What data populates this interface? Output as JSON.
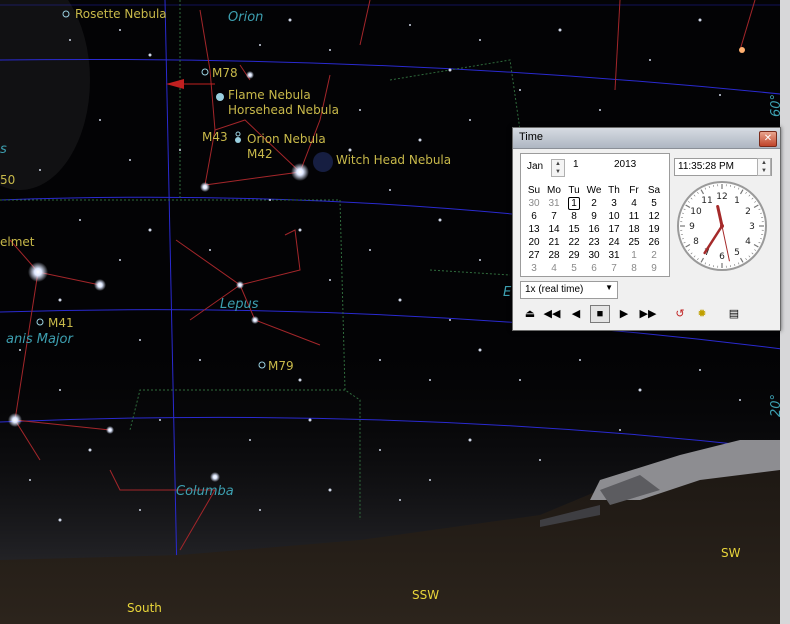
{
  "sky": {
    "labels": {
      "rosette": "Rosette Nebula",
      "orion": "Orion",
      "m78": "M78",
      "flame": "Flame Nebula",
      "horsehead": "Horsehead Nebula",
      "m43": "M43",
      "orion_nebula": "Orion Nebula",
      "m42": "M42",
      "witch_head": "Witch Head Nebula",
      "lepus": "Lepus",
      "m41": "M41",
      "canis_major": "anis Major",
      "helmet": "elmet",
      "m79": "M79",
      "columba": "Columba",
      "edge_s": "s",
      "edge_50": "50",
      "right_edge_top": "60°",
      "right_edge_bottom": "20°",
      "right_e": "E"
    },
    "directions": {
      "south": "South",
      "ssw": "SSW",
      "sw": "SW"
    },
    "colors": {
      "label": "#c8b94a",
      "constellation": "#3d9fb0",
      "direction": "#e8d53a"
    }
  },
  "time_dialog": {
    "title": "Time",
    "close_icon": "close-icon",
    "month": "Jan",
    "day": "1",
    "year": "2013",
    "weekdays": [
      "Su",
      "Mo",
      "Tu",
      "We",
      "Th",
      "Fr",
      "Sa"
    ],
    "weeks": [
      [
        "30",
        "31",
        "1",
        "2",
        "3",
        "4",
        "5"
      ],
      [
        "6",
        "7",
        "8",
        "9",
        "10",
        "11",
        "12"
      ],
      [
        "13",
        "14",
        "15",
        "16",
        "17",
        "18",
        "19"
      ],
      [
        "20",
        "21",
        "22",
        "23",
        "24",
        "25",
        "26"
      ],
      [
        "27",
        "28",
        "29",
        "30",
        "31",
        "1",
        "2"
      ],
      [
        "3",
        "4",
        "5",
        "6",
        "7",
        "8",
        "9"
      ]
    ],
    "time": "11:35:28 PM",
    "clock": {
      "hours": 11,
      "minutes": 35,
      "seconds": 28
    },
    "rate": "1x (real time)",
    "controls": [
      "eject-icon",
      "rewind-fast-icon",
      "step-back-icon",
      "stop-icon",
      "play-icon",
      "fast-forward-icon",
      "reset-icon",
      "now-icon",
      "options-icon"
    ]
  }
}
